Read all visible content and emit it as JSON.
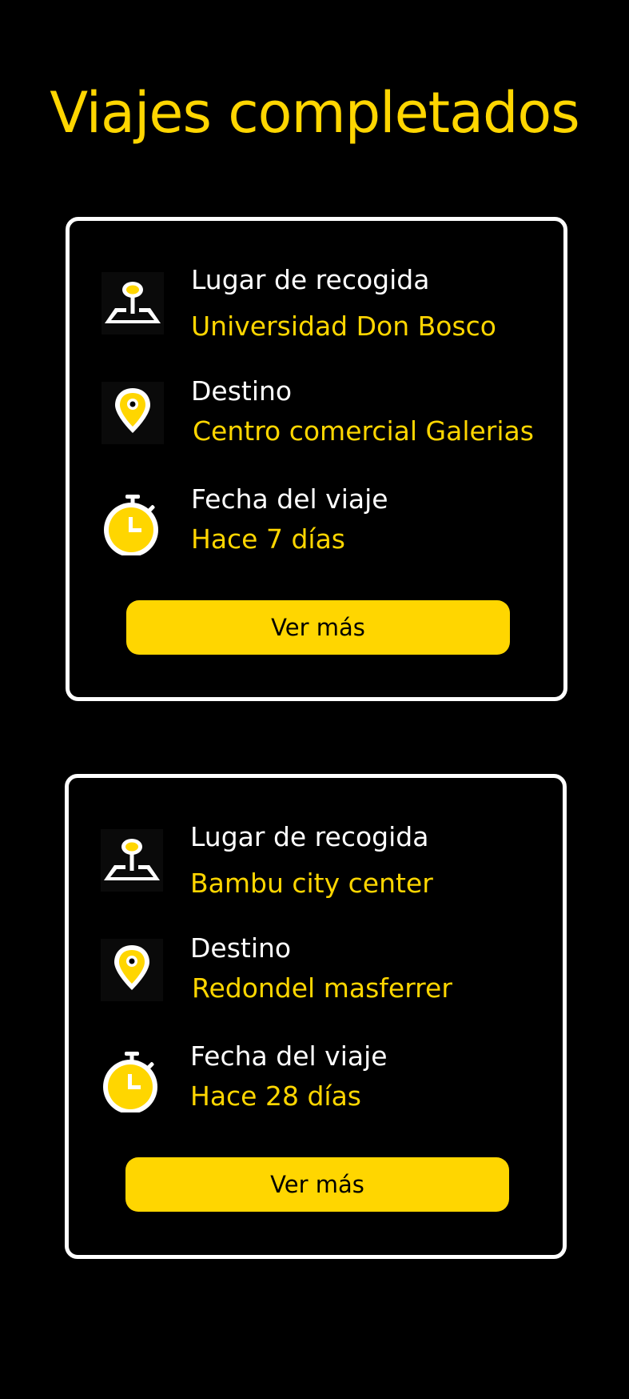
{
  "page": {
    "title": "Viajes completados"
  },
  "colors": {
    "background": "#000000",
    "accent": "#FFD600",
    "text": "#FFFFFF"
  },
  "icons": {
    "pickup": "pickup-location-icon",
    "destination": "map-pin-icon",
    "date": "stopwatch-icon"
  },
  "trips": [
    {
      "pickup_label": "Lugar de recogida",
      "pickup_value": "Universidad Don Bosco",
      "destination_label": "Destino",
      "destination_value": "Centro comercial Galerias",
      "date_label": "Fecha del viaje",
      "date_value": "Hace 7 días",
      "button_label": "Ver más"
    },
    {
      "pickup_label": "Lugar de recogida",
      "pickup_value": "Bambu city center",
      "destination_label": "Destino",
      "destination_value": "Redondel masferrer",
      "date_label": "Fecha del viaje",
      "date_value": "Hace 28 días",
      "button_label": "Ver más"
    }
  ]
}
